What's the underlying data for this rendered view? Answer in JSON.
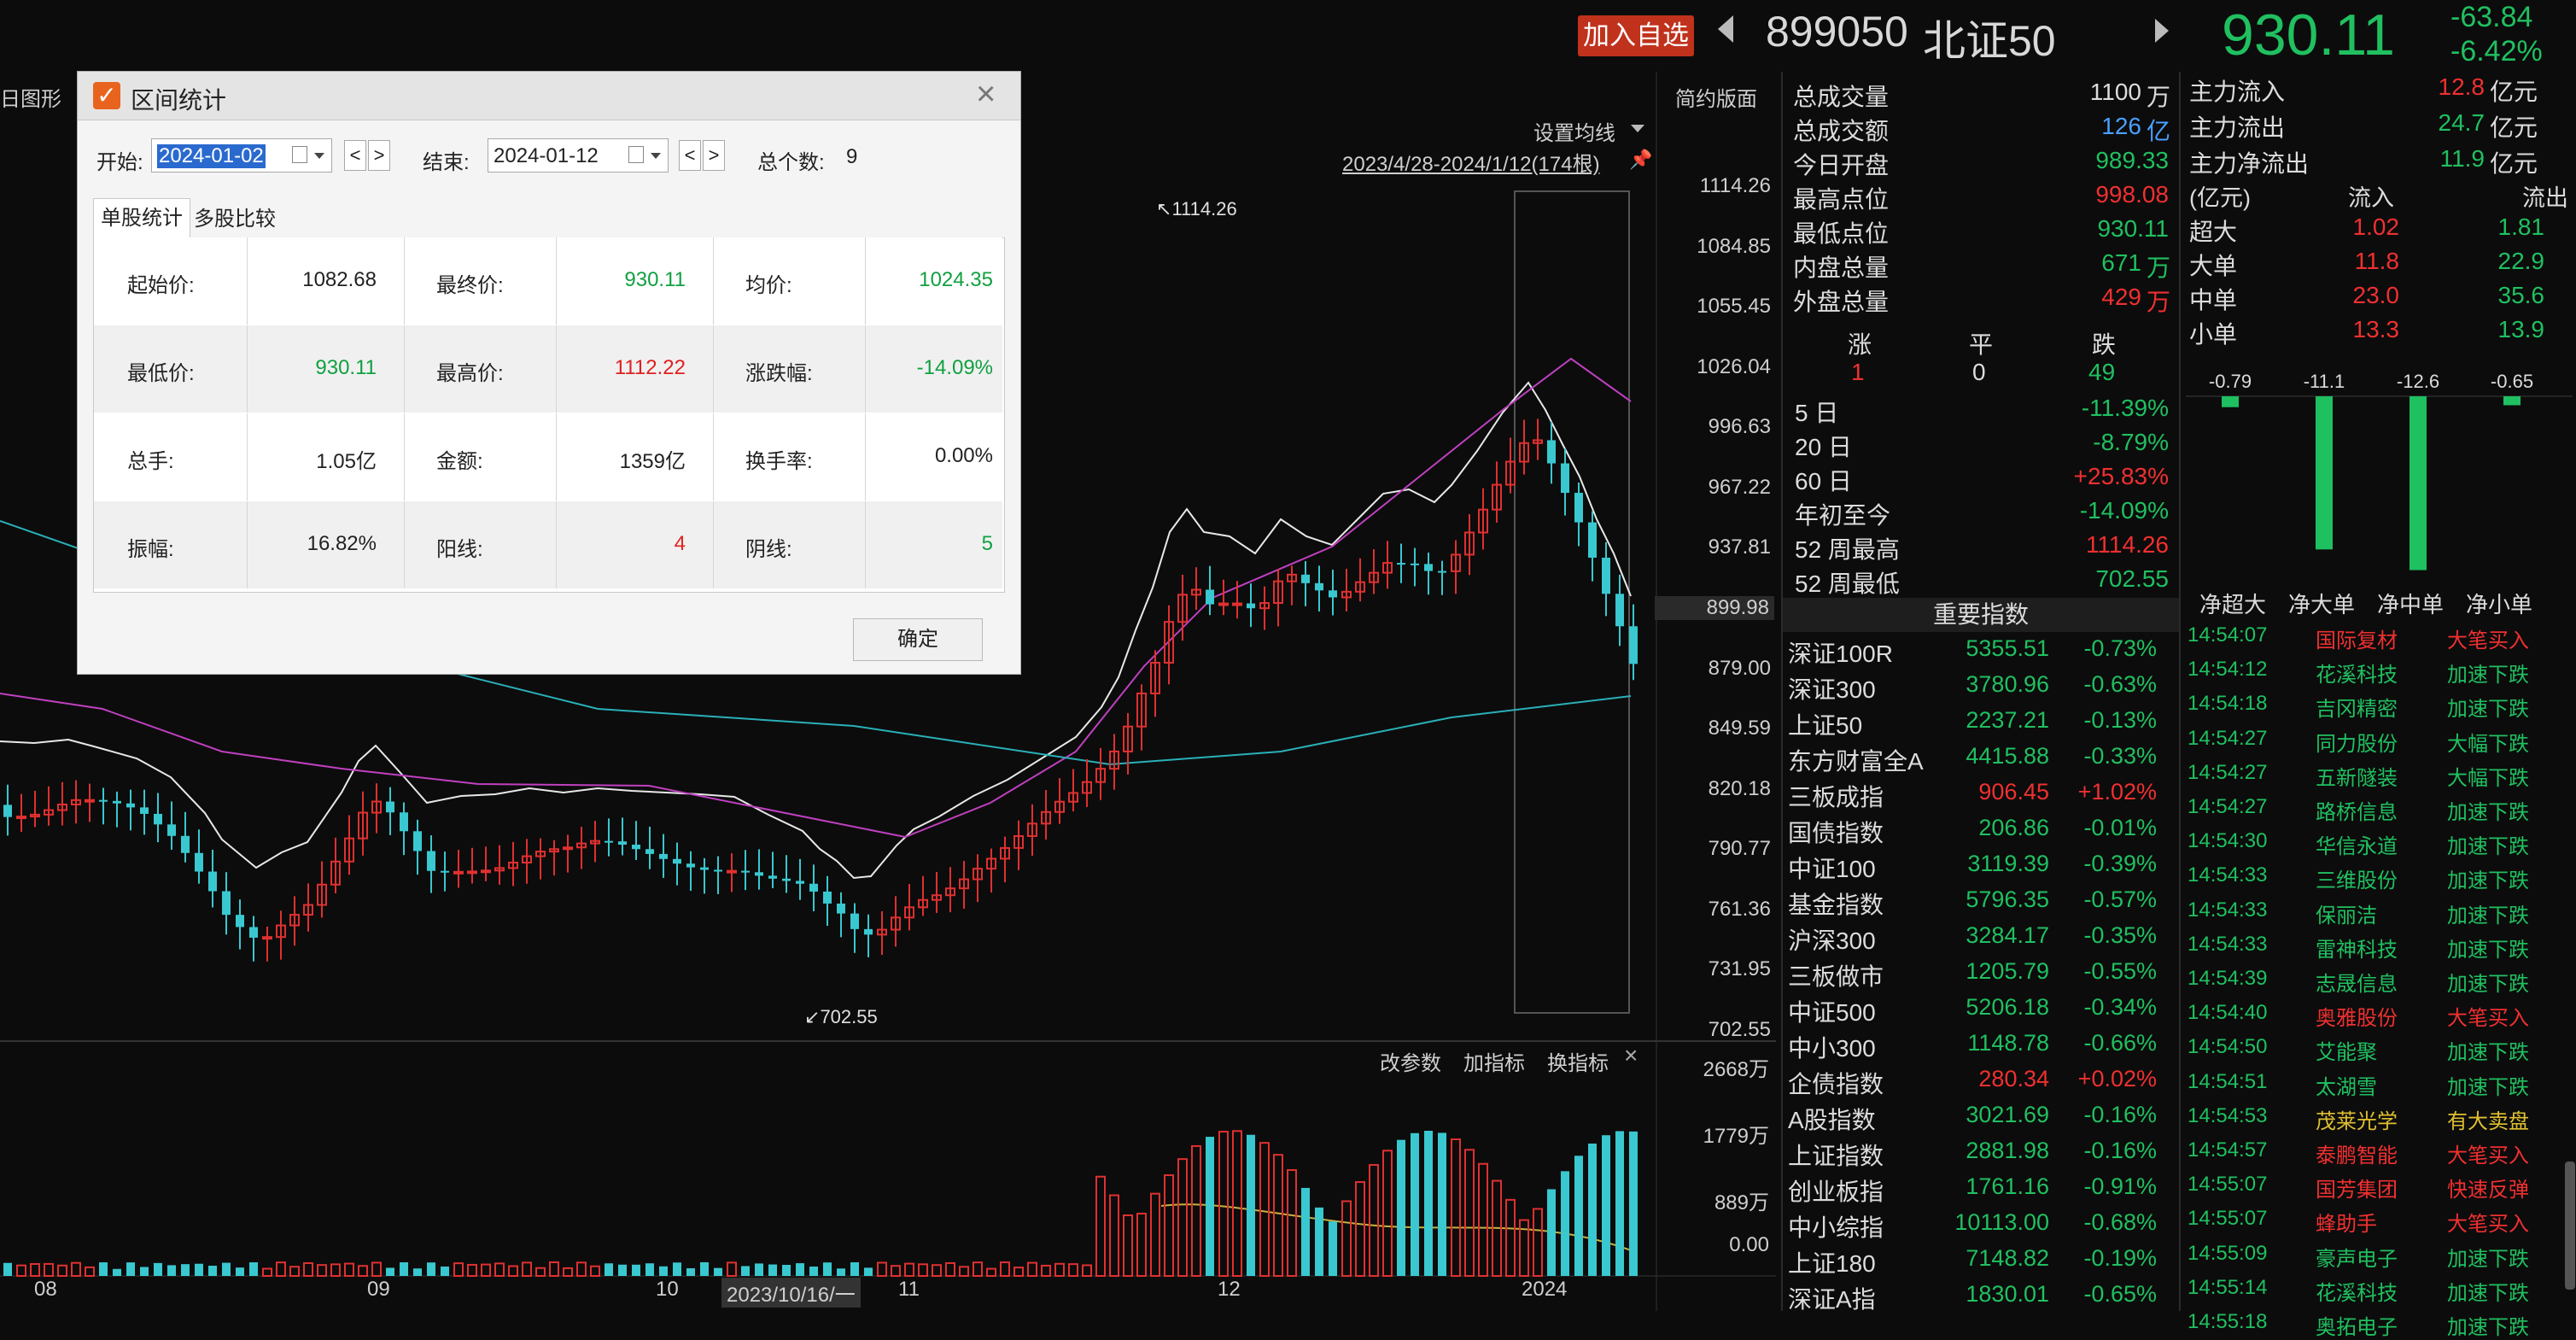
{
  "header": {
    "add_fav": "加入自选",
    "code": "899050",
    "name": "北证50",
    "price": "930.11",
    "change": "-63.84",
    "change_pct": "-6.42%"
  },
  "toolbar": {
    "partial_left": "日图形",
    "simple_layout": "简约版面",
    "ma_settings": "设置均线",
    "range_info": "2023/4/28-2024/1/12(174根)"
  },
  "y_axis": [
    "1114.26",
    "1084.85",
    "1055.45",
    "1026.04",
    "996.63",
    "967.22",
    "937.81",
    "899.98",
    "879.00",
    "849.59",
    "820.18",
    "790.77",
    "761.36",
    "731.95",
    "702.55"
  ],
  "chart_annotations": {
    "high": "1114.26",
    "low": "702.55"
  },
  "vol_axis": [
    "2668万",
    "1779万",
    "889万",
    "0.00"
  ],
  "vol_toolbar": {
    "change_params": "改参数",
    "add_indicator": "加指标",
    "switch_indicator": "换指标"
  },
  "x_axis": [
    "08",
    "09",
    "10",
    "2023/10/16/一",
    "11",
    "12",
    "2024"
  ],
  "chart_data": {
    "type": "candlestick",
    "ylim": [
      702.55,
      1114.26
    ],
    "high": 1114.26,
    "low": 702.55,
    "range": "2023/4/28-2024/1/12(174根)"
  },
  "stats": {
    "total_volume": {
      "label": "总成交量",
      "value": "1100",
      "unit": "万"
    },
    "total_amount": {
      "label": "总成交额",
      "value": "126",
      "unit": "亿"
    },
    "open": {
      "label": "今日开盘",
      "value": "989.33"
    },
    "highest": {
      "label": "最高点位",
      "value": "998.08"
    },
    "lowest": {
      "label": "最低点位",
      "value": "930.11"
    },
    "inner": {
      "label": "内盘总量",
      "value": "671",
      "unit": "万"
    },
    "outer": {
      "label": "外盘总量",
      "value": "429",
      "unit": "万"
    },
    "rise_label": "涨",
    "flat_label": "平",
    "fall_label": "跌",
    "rise": "1",
    "flat": "0",
    "fall": "49",
    "periods": [
      {
        "label": "5 日",
        "value": "-11.39%",
        "dir": "down"
      },
      {
        "label": "20 日",
        "value": "-8.79%",
        "dir": "down"
      },
      {
        "label": "60 日",
        "value": "+25.83%",
        "dir": "up"
      },
      {
        "label": "年初至今",
        "value": "-14.09%",
        "dir": "down"
      },
      {
        "label": "52 周最高",
        "value": "1114.26",
        "dir": "up"
      },
      {
        "label": "52 周最低",
        "value": "702.55",
        "dir": "down"
      }
    ]
  },
  "indices_title": "重要指数",
  "indices": [
    {
      "name": "深证100R",
      "value": "5355.51",
      "pct": "-0.73%",
      "dir": "down"
    },
    {
      "name": "深证300",
      "value": "3780.96",
      "pct": "-0.63%",
      "dir": "down"
    },
    {
      "name": "上证50",
      "value": "2237.21",
      "pct": "-0.13%",
      "dir": "down"
    },
    {
      "name": "东方财富全A",
      "value": "4415.88",
      "pct": "-0.33%",
      "dir": "down"
    },
    {
      "name": "三板成指",
      "value": "906.45",
      "pct": "+1.02%",
      "dir": "up"
    },
    {
      "name": "国债指数",
      "value": "206.86",
      "pct": "-0.01%",
      "dir": "down"
    },
    {
      "name": "中证100",
      "value": "3119.39",
      "pct": "-0.39%",
      "dir": "down"
    },
    {
      "name": "基金指数",
      "value": "5796.35",
      "pct": "-0.57%",
      "dir": "down"
    },
    {
      "name": "沪深300",
      "value": "3284.17",
      "pct": "-0.35%",
      "dir": "down"
    },
    {
      "name": "三板做市",
      "value": "1205.79",
      "pct": "-0.55%",
      "dir": "down"
    },
    {
      "name": "中证500",
      "value": "5206.18",
      "pct": "-0.34%",
      "dir": "down"
    },
    {
      "name": "中小300",
      "value": "1148.78",
      "pct": "-0.66%",
      "dir": "down"
    },
    {
      "name": "企债指数",
      "value": "280.34",
      "pct": "+0.02%",
      "dir": "up"
    },
    {
      "name": "A股指数",
      "value": "3021.69",
      "pct": "-0.16%",
      "dir": "down"
    },
    {
      "name": "上证指数",
      "value": "2881.98",
      "pct": "-0.16%",
      "dir": "down"
    },
    {
      "name": "创业板指",
      "value": "1761.16",
      "pct": "-0.91%",
      "dir": "down"
    },
    {
      "name": "中小综指",
      "value": "10113.00",
      "pct": "-0.68%",
      "dir": "down"
    },
    {
      "name": "上证180",
      "value": "7148.82",
      "pct": "-0.19%",
      "dir": "down"
    },
    {
      "name": "深证A指",
      "value": "1830.01",
      "pct": "-0.65%",
      "dir": "down"
    }
  ],
  "capital": {
    "in_label": "主力流入",
    "in_value": "12.8",
    "in_unit": "亿元",
    "out_label": "主力流出",
    "out_value": "24.7",
    "out_unit": "亿元",
    "net_label": "主力净流出",
    "net_value": "11.9",
    "net_unit": "亿元",
    "unit_label": "(亿元)",
    "flow_in": "流入",
    "flow_out": "流出",
    "rows": [
      {
        "label": "超大",
        "in": "1.02",
        "out": "1.81"
      },
      {
        "label": "大单",
        "in": "11.8",
        "out": "22.9"
      },
      {
        "label": "中单",
        "in": "23.0",
        "out": "35.6"
      },
      {
        "label": "小单",
        "in": "13.3",
        "out": "13.9"
      }
    ],
    "bars": [
      {
        "label": "净超大",
        "value": -0.79,
        "text": "-0.79"
      },
      {
        "label": "净大单",
        "value": -11.1,
        "text": "-11.1"
      },
      {
        "label": "净中单",
        "value": -12.6,
        "text": "-12.6"
      },
      {
        "label": "净小单",
        "value": -0.65,
        "text": "-0.65"
      }
    ]
  },
  "ticks": [
    {
      "time": "14:54:07",
      "name": "国际复材",
      "action": "大笔买入",
      "color": "red"
    },
    {
      "time": "14:54:12",
      "name": "花溪科技",
      "action": "加速下跌",
      "color": "grn"
    },
    {
      "time": "14:54:18",
      "name": "吉冈精密",
      "action": "加速下跌",
      "color": "grn"
    },
    {
      "time": "14:54:27",
      "name": "同力股份",
      "action": "大幅下跌",
      "color": "grn"
    },
    {
      "time": "14:54:27",
      "name": "五新隧装",
      "action": "大幅下跌",
      "color": "grn"
    },
    {
      "time": "14:54:27",
      "name": "路桥信息",
      "action": "加速下跌",
      "color": "grn"
    },
    {
      "time": "14:54:30",
      "name": "华信永道",
      "action": "加速下跌",
      "color": "grn"
    },
    {
      "time": "14:54:33",
      "name": "三维股份",
      "action": "加速下跌",
      "color": "grn"
    },
    {
      "time": "14:54:33",
      "name": "保丽洁",
      "action": "加速下跌",
      "color": "grn"
    },
    {
      "time": "14:54:33",
      "name": "雷神科技",
      "action": "加速下跌",
      "color": "grn"
    },
    {
      "time": "14:54:39",
      "name": "志晟信息",
      "action": "加速下跌",
      "color": "grn"
    },
    {
      "time": "14:54:40",
      "name": "奥雅股份",
      "action": "大笔买入",
      "color": "red"
    },
    {
      "time": "14:54:50",
      "name": "艾能聚",
      "action": "加速下跌",
      "color": "grn"
    },
    {
      "time": "14:54:51",
      "name": "太湖雪",
      "action": "加速下跌",
      "color": "grn"
    },
    {
      "time": "14:54:53",
      "name": "茂莱光学",
      "action": "有大卖盘",
      "color": "yel"
    },
    {
      "time": "14:54:57",
      "name": "泰鹏智能",
      "action": "大笔买入",
      "color": "red"
    },
    {
      "time": "14:55:07",
      "name": "国芳集团",
      "action": "快速反弹",
      "color": "red"
    },
    {
      "time": "14:55:07",
      "name": "蜂助手",
      "action": "大笔买入",
      "color": "red"
    },
    {
      "time": "14:55:09",
      "name": "豪声电子",
      "action": "加速下跌",
      "color": "grn"
    },
    {
      "time": "14:55:14",
      "name": "花溪科技",
      "action": "加速下跌",
      "color": "grn"
    },
    {
      "time": "14:55:18",
      "name": "奥拓电子",
      "action": "加速下跌",
      "color": "grn"
    }
  ],
  "dialog": {
    "title": "区间统计",
    "start_label": "开始:",
    "start_date": "2024-01-02",
    "end_label": "结束:",
    "end_date": "2024-01-12",
    "count_label": "总个数:",
    "count": "9",
    "tab_single": "单股统计",
    "tab_multi": "多股比较",
    "rows": [
      [
        {
          "label": "起始价:",
          "value": "1082.68",
          "c": "wht"
        },
        {
          "label": "最终价:",
          "value": "930.11",
          "c": "grn"
        },
        {
          "label": "均价:",
          "value": "1024.35",
          "c": "grn"
        }
      ],
      [
        {
          "label": "最低价:",
          "value": "930.11",
          "c": "grn"
        },
        {
          "label": "最高价:",
          "value": "1112.22",
          "c": "red"
        },
        {
          "label": "涨跌幅:",
          "value": "-14.09%",
          "c": "grn"
        }
      ],
      [
        {
          "label": "总手:",
          "value": "1.05亿",
          "c": "wht"
        },
        {
          "label": "金额:",
          "value": "1359亿",
          "c": "wht"
        },
        {
          "label": "换手率:",
          "value": "0.00%",
          "c": "wht"
        }
      ],
      [
        {
          "label": "振幅:",
          "value": "16.82%",
          "c": "wht"
        },
        {
          "label": "阳线:",
          "value": "4",
          "c": "red"
        },
        {
          "label": "阴线:",
          "value": "5",
          "c": "grn"
        }
      ]
    ],
    "ok": "确定"
  }
}
